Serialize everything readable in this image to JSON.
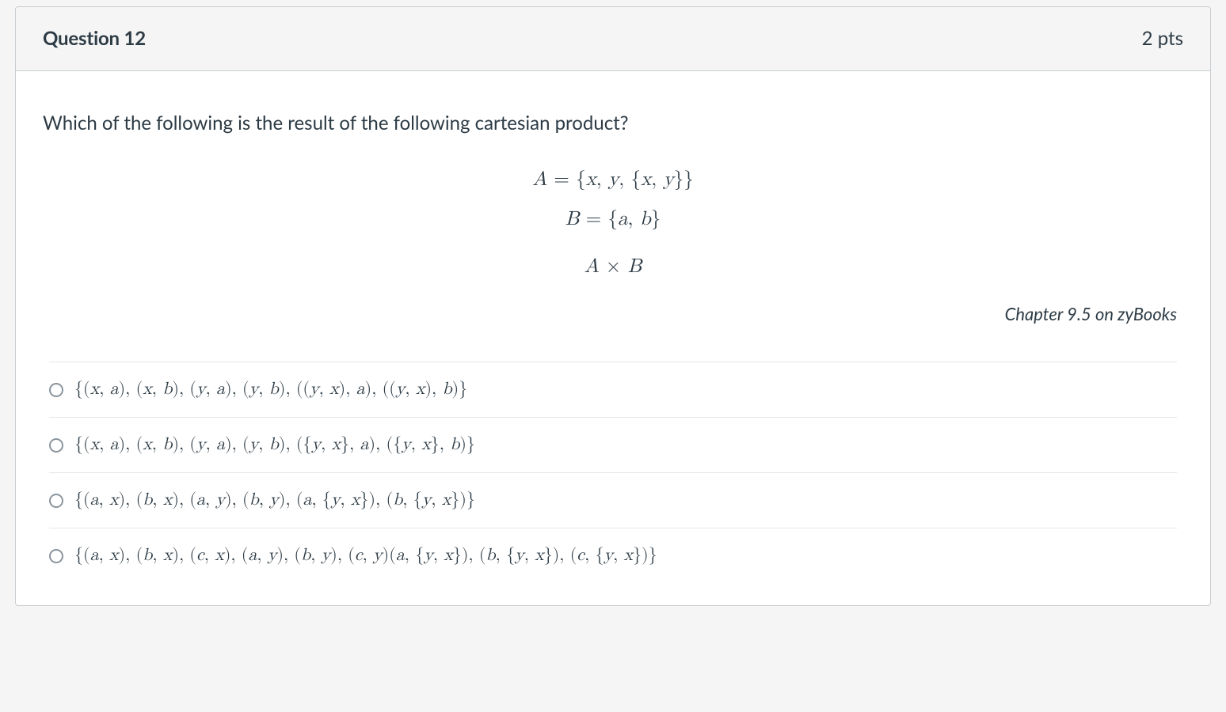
{
  "header": {
    "title": "Question 12",
    "points": "2 pts"
  },
  "body": {
    "prompt": "Which of the following is the result of the following cartesian product?",
    "mathA": "A = {x, y, {x, y}}",
    "mathB": "B = {a, b}",
    "mathOp": "A × B",
    "reference": "Chapter 9.5 on zyBooks"
  },
  "options": [
    "{(x, a), (x, b), (y, a), (y, b), ((y, x), a), ((y, x), b)}",
    "{(x, a), (x, b), (y, a), (y, b), ({y, x}, a), ({y, x}, b)}",
    "{(a, x), (b, x), (a, y), (b, y), (a, {y, x}), (b, {y, x})}",
    "{(a, x), (b, x), (c, x), (a, y), (b, y), (c, y)(a, {y, x}), (b, {y, x}), (c, {y, x})}"
  ]
}
